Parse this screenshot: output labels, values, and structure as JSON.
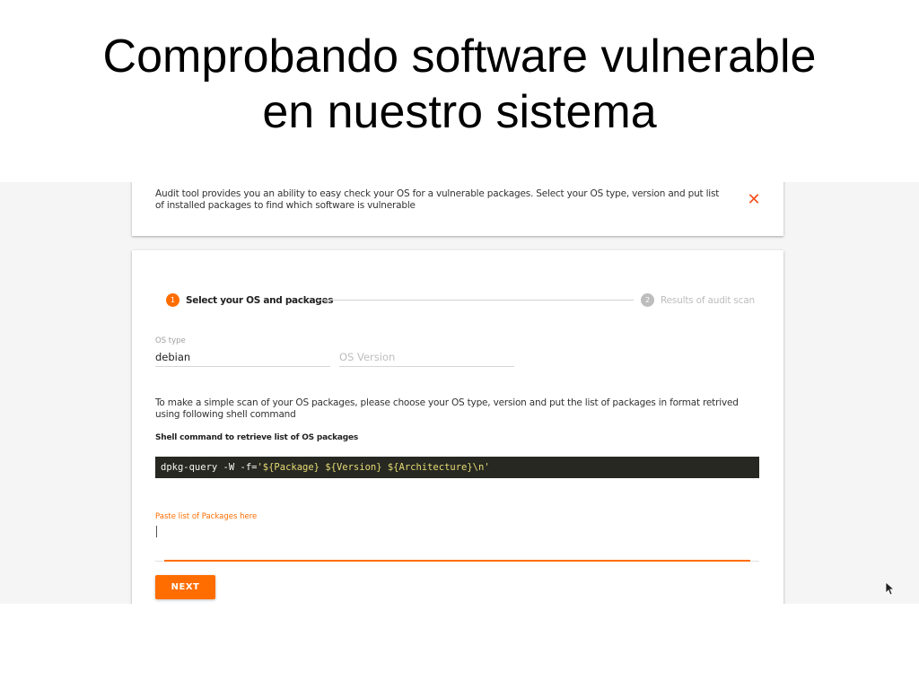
{
  "slide": {
    "title_line1": "Comprobando software vulnerable",
    "title_line2": "en nuestro sistema"
  },
  "info_banner": {
    "text": "Audit tool provides you an ability to easy check your OS for a vulnerable packages. Select your OS type, version and put list of installed packages to find which software is vulnerable",
    "close_icon": "✕"
  },
  "stepper": {
    "steps": [
      {
        "number": "1",
        "label": "Select your OS and packages",
        "state": "active"
      },
      {
        "number": "2",
        "label": "Results of audit scan",
        "state": "inactive"
      }
    ]
  },
  "form": {
    "os_type": {
      "label": "OS type",
      "value": "debian"
    },
    "os_version": {
      "placeholder": "OS Version"
    },
    "description": "To make a simple scan of your OS packages, please choose your OS type, version and put the list of packages in format retrived using following shell command",
    "command_heading": "Shell command to retrieve list of OS packages",
    "command_prefix": "dpkg-query -W -f=",
    "command_string": "'${Package} ${Version} ${Architecture}\\n'",
    "packages_label": "Paste list of Packages here",
    "next_label": "NEXT"
  },
  "colors": {
    "accent": "#ff6d00",
    "close": "#f4511e",
    "code_background": "#272822",
    "code_string": "#e6db74"
  },
  "icons": {
    "close": "close-icon",
    "pointer": "mouse-pointer-icon"
  }
}
